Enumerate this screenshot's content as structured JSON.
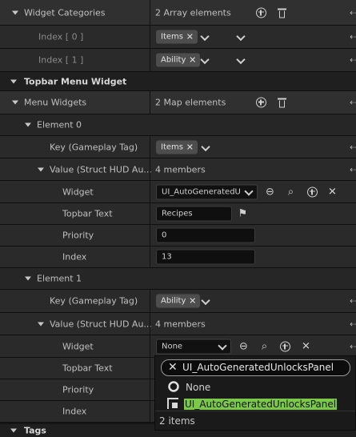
{
  "widget_categories": {
    "label": "Widget Categories",
    "summary": "2 Array elements",
    "items": [
      {
        "index": "Index [ 0 ]",
        "tag": "Items"
      },
      {
        "index": "Index [ 1 ]",
        "tag": "Ability"
      }
    ]
  },
  "topbar_section": {
    "label": "Topbar Menu Widget"
  },
  "menu_widgets": {
    "label": "Menu Widgets",
    "summary": "2 Map elements",
    "elements": [
      {
        "label": "Element 0",
        "key_label": "Key (Gameplay Tag)",
        "key_value": "Items",
        "value_label": "Value (Struct HUD Au...",
        "value_summary": "4 members",
        "widget_label": "Widget",
        "widget_value": "UI_AutoGeneratedU",
        "topbar_text_label": "Topbar Text",
        "topbar_text_value": "Recipes",
        "priority_label": "Priority",
        "priority_value": "0",
        "index_label": "Index",
        "index_value": "13"
      },
      {
        "label": "Element 1",
        "key_label": "Key (Gameplay Tag)",
        "key_value": "Ability",
        "value_label": "Value (Struct HUD Au...",
        "value_summary": "4 members",
        "widget_label": "Widget",
        "widget_value": "None",
        "topbar_text_label": "Topbar Text",
        "priority_label": "Priority",
        "index_label": "Index"
      }
    ]
  },
  "tags_section": {
    "label": "Tags"
  },
  "asset_picker": {
    "search_value": "UI_AutoGeneratedUnlocksPanel",
    "options": [
      "None",
      "UI_AutoGeneratedUnlocksPanel"
    ],
    "count_label": "2 items",
    "highlight_color": "#7cc94a"
  }
}
